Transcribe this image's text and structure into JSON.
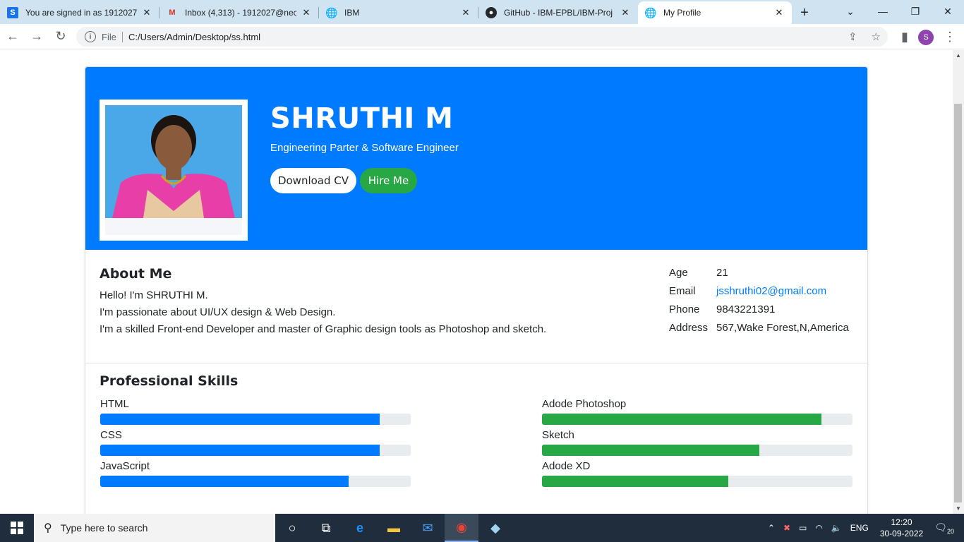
{
  "browser": {
    "tabs": [
      {
        "title": "You are signed in as 1912027",
        "icon": "S"
      },
      {
        "title": "Inbox (4,313) - 1912027@nec",
        "icon": "M"
      },
      {
        "title": "IBM",
        "icon": "globe"
      },
      {
        "title": "GitHub - IBM-EPBL/IBM-Proj",
        "icon": "github"
      },
      {
        "title": "My Profile",
        "icon": "globe"
      }
    ],
    "file_label": "File",
    "url": "C:/Users/Admin/Desktop/ss.html",
    "profile_initial": "S"
  },
  "profile": {
    "name": "SHRUTHI M",
    "subtitle": "Engineering Parter & Software Engineer",
    "download_cv": "Download CV",
    "hire_me": "Hire Me"
  },
  "about": {
    "title": "About Me",
    "lines": [
      "Hello! I'm SHRUTHI M.",
      "I'm passionate about UI/UX design & Web Design.",
      "I'm a skilled Front-end Developer and master of Graphic design tools as Photoshop and sketch."
    ]
  },
  "info": [
    {
      "key": "Age",
      "value": "21"
    },
    {
      "key": "Email",
      "value": "jsshruthi02@gmail.com"
    },
    {
      "key": "Phone",
      "value": "9843221391"
    },
    {
      "key": "Address",
      "value": "567,Wake Forest,N,America"
    }
  ],
  "skills": {
    "title": "Professional Skills",
    "left": [
      {
        "name": "HTML",
        "percent": 90
      },
      {
        "name": "CSS",
        "percent": 90
      },
      {
        "name": "JavaScript",
        "percent": 80
      }
    ],
    "right": [
      {
        "name": "Adode Photoshop",
        "percent": 90
      },
      {
        "name": "Sketch",
        "percent": 70
      },
      {
        "name": "Adode XD",
        "percent": 60
      }
    ],
    "left_color": "#007bff",
    "right_color": "#28a745"
  },
  "taskbar": {
    "search_placeholder": "Type here to search",
    "language": "ENG",
    "time": "12:20",
    "date": "30-09-2022",
    "notifications": "20"
  }
}
